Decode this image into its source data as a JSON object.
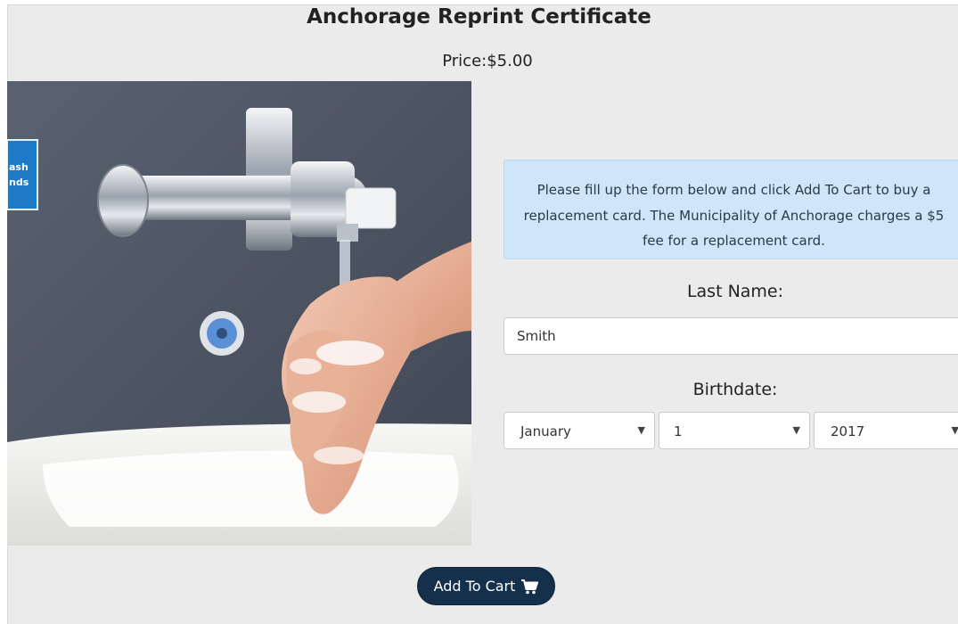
{
  "header": {
    "title": "Anchorage Reprint Certificate",
    "price": "Price:$5.00"
  },
  "image": {
    "sign_text_line1": "ash",
    "sign_text_line2": "nds"
  },
  "info": {
    "message": "Please fill up the form below and click Add To Cart to buy a replacement card. The Municipality of Anchorage charges a $5 fee for a replacement card."
  },
  "form": {
    "last_name_label": "Last Name:",
    "last_name_value": "Smith",
    "birthdate_label": "Birthdate:",
    "month_value": "January",
    "day_value": "1",
    "year_value": "2017"
  },
  "actions": {
    "add_to_cart_label": "Add To Cart",
    "cart_icon": "shopping-cart-icon"
  }
}
